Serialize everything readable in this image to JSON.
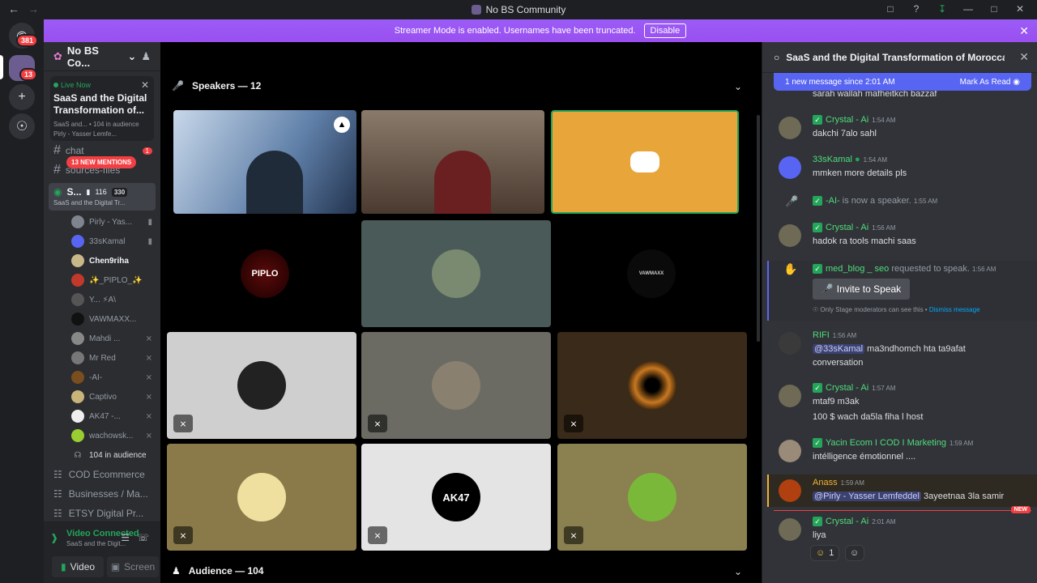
{
  "window": {
    "title": "No BS Community"
  },
  "banner": {
    "text": "Streamer Mode is enabled. Usernames have been truncated.",
    "disable": "Disable"
  },
  "guilds": {
    "home_badge": "381",
    "server_badge": "13"
  },
  "sidebar": {
    "server_name": "No BS Co...",
    "live": {
      "label": "Live Now",
      "title": "SaaS and the Digital Transformation of...",
      "sub": "SaaS and... • 104 in audience",
      "users": "Pirly - Yasser Lemfe..."
    },
    "channels": [
      {
        "name": "chat",
        "badge": "1"
      },
      {
        "name": "sources-files"
      }
    ],
    "mentions": "13 NEW MENTIONS",
    "stage": {
      "name": "S...",
      "video_count": "116",
      "count2": "330",
      "topic": "SaaS and the Digital Tr..."
    },
    "users": [
      {
        "name": "Pirly - Yas...",
        "color": "#80848e"
      },
      {
        "name": "33sKamal",
        "color": "#5865f2"
      },
      {
        "name": "Chen9riha",
        "color": "#c9b88a"
      },
      {
        "name": "✨_PIPLO_✨",
        "color": "#c0392b"
      },
      {
        "name": "Y... ⚡A\\",
        "color": "#555"
      },
      {
        "name": "VAWMAXX...",
        "color": "#111"
      },
      {
        "name": "Mahdi ...",
        "color": "#888"
      },
      {
        "name": "Mr Red",
        "color": "#777"
      },
      {
        "name": "-AI-",
        "color": "#7a4e1e"
      },
      {
        "name": "Captivo",
        "color": "#c8b478"
      },
      {
        "name": "AK47 -...",
        "color": "#eee"
      },
      {
        "name": "wachowsk...",
        "color": "#9acd32"
      }
    ],
    "audience": "104 in audience",
    "categories": [
      "COD Ecommerce",
      "Businesses / Ma...",
      "ETSY Digital Pr..."
    ],
    "voice": {
      "status": "Video Connected",
      "sub": "SaaS and the Digit...",
      "video": "Video",
      "screen": "Screen"
    }
  },
  "stage": {
    "speakers": "Speakers — 12",
    "audience": "Audience — 104",
    "tile_labels": {
      "piplo": "PIPLO",
      "vawmaxx": "VAWMAXX",
      "ak47": "AK47"
    }
  },
  "thread": {
    "title": "SaaS and the Digital Transformation of Moroccan In",
    "newbar": "1 new message since 2:01 AM",
    "mark_read": "Mark As Read",
    "messages": [
      {
        "name": "",
        "time": "",
        "text": "sarah wallah mafheitkch bazzaf"
      },
      {
        "name": "Crystal - Ai",
        "time": "1:54 AM",
        "text": "dakchi 7alo sahl"
      },
      {
        "name": "33sKamal",
        "time": "1:54 AM",
        "text": "mmken more details pls"
      },
      {
        "name": "Crystal - Ai",
        "time": "1:56 AM",
        "text": "hadok ra tools machi saas"
      },
      {
        "name": "RIFI",
        "time": "1:56 AM",
        "mention": "@33sKamal",
        "text": "ma3ndhomch hta ta9afat",
        "text2": "conversation"
      },
      {
        "name": "Crystal - Ai",
        "time": "1:57 AM",
        "text": "mtaf9 m3ak",
        "text2": "100 $ wach da5la fiha l host"
      },
      {
        "name": "Yacin Ecom I COD I Marketing",
        "time": "1:59 AM",
        "text": "intélligence émotionnel ...."
      },
      {
        "name": "Anass",
        "time": "1:59 AM",
        "mention": "@Pirly - Yasser Lemfeddel",
        "text": "3ayeetnaa 3la samir"
      },
      {
        "name": "Crystal - Ai",
        "time": "2:01 AM",
        "text": "liya"
      }
    ],
    "speaker_event": {
      "name": "-AI-",
      "text": "is now a speaker.",
      "time": "1:55 AM"
    },
    "request": {
      "name": "med_blog _ seo",
      "text": "requested to speak.",
      "time": "1:56 AM",
      "button": "Invite to Speak",
      "note": "Only Stage moderators can see this •",
      "dismiss": "Dismiss message"
    },
    "new_tag": "NEW",
    "reaction_count": "1"
  }
}
